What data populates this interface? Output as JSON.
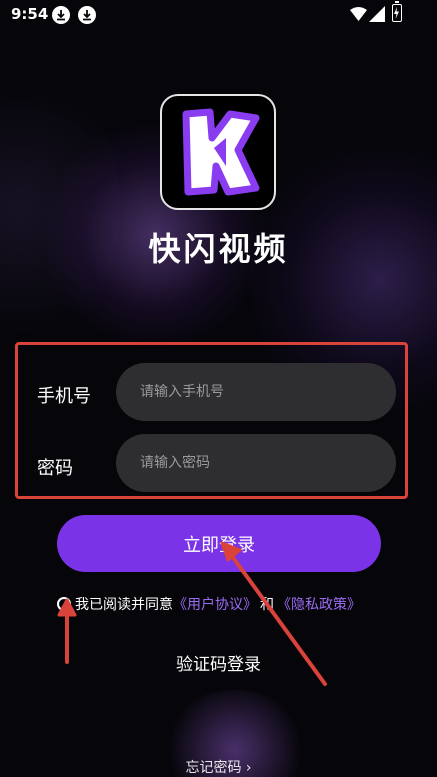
{
  "status_bar": {
    "time": "9:54",
    "icons": [
      "download-icon",
      "download-icon",
      "wifi-icon",
      "signal-icon",
      "battery-charging-icon"
    ]
  },
  "app": {
    "logo_icon": "app-logo-k-icon",
    "title": "快闪视频"
  },
  "form": {
    "phone_label": "手机号",
    "phone_placeholder": "请输入手机号",
    "phone_value": "",
    "password_label": "密码",
    "password_placeholder": "请输入密码",
    "password_value": ""
  },
  "login_button": "立即登录",
  "agreement": {
    "prefix": "我已阅读并同意",
    "user_agreement": "《用户协议》",
    "and": "和",
    "privacy_policy": "《隐私政策》",
    "checked": false
  },
  "sms_login": "验证码登录",
  "forgot_password": "忘记密码",
  "forgot_chevron": "›",
  "colors": {
    "background": "#06050a",
    "accent": "#7b33e8",
    "link": "#9b6cf3",
    "input_bg": "#2e2e30",
    "annotation_red": "#d9433a"
  }
}
